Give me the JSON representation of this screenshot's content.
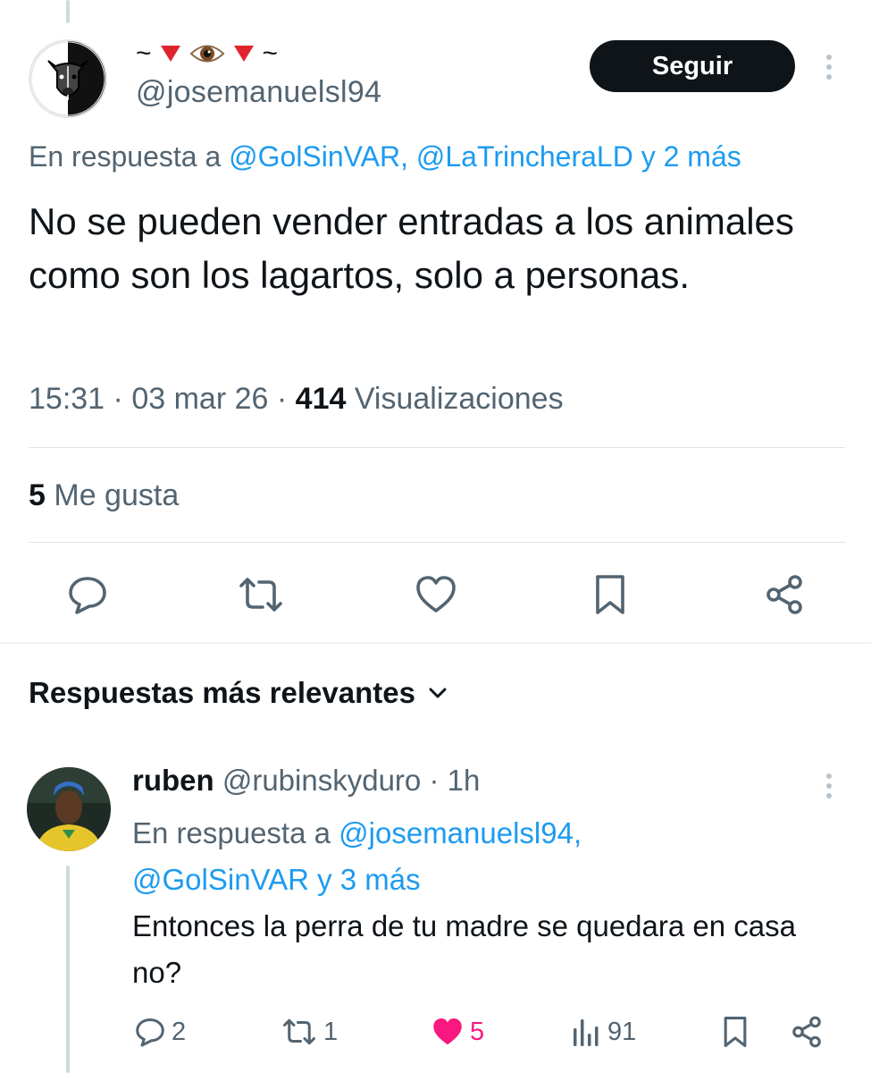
{
  "main_tweet": {
    "display_name_chars": [
      "~",
      "🔻",
      "👁",
      "🔻",
      "~"
    ],
    "handle": "@josemanuelsl94",
    "follow_label": "Seguir",
    "reply_prefix": "En respuesta a",
    "reply_mentions": "@GolSinVAR, @LaTrincheraLD y 2 más",
    "text": "No se pueden vender entradas a los animales como son los lagartos, solo a personas.",
    "time": "15:31",
    "date": "03 mar 26",
    "sep": "·",
    "views_count": "414",
    "views_label": "Visualizaciones",
    "likes_count": "5",
    "likes_label": "Me gusta",
    "action_icons": [
      "reply-icon",
      "retweet-icon",
      "like-icon",
      "bookmark-icon",
      "share-icon"
    ]
  },
  "replies_header": {
    "label": "Respuestas más relevantes",
    "icon": "chevron-down-icon"
  },
  "reply": {
    "name": "ruben",
    "handle": "@rubinskyduro",
    "sep": "·",
    "time": "1h",
    "reply_prefix": "En respuesta a",
    "reply_mentions_1": "@josemanuelsl94,",
    "reply_mentions_2": "@GolSinVAR y 3 más",
    "text": "Entonces la perra de tu madre se quedara en casa no?",
    "replies_count": "2",
    "retweets_count": "1",
    "likes_count": "5",
    "views_count": "91",
    "like_color": "#f91880"
  },
  "colors": {
    "text": "#0f1419",
    "muted": "#536471",
    "link": "#1d9bf0",
    "like": "#f91880",
    "follow_bg": "#0f1419"
  }
}
